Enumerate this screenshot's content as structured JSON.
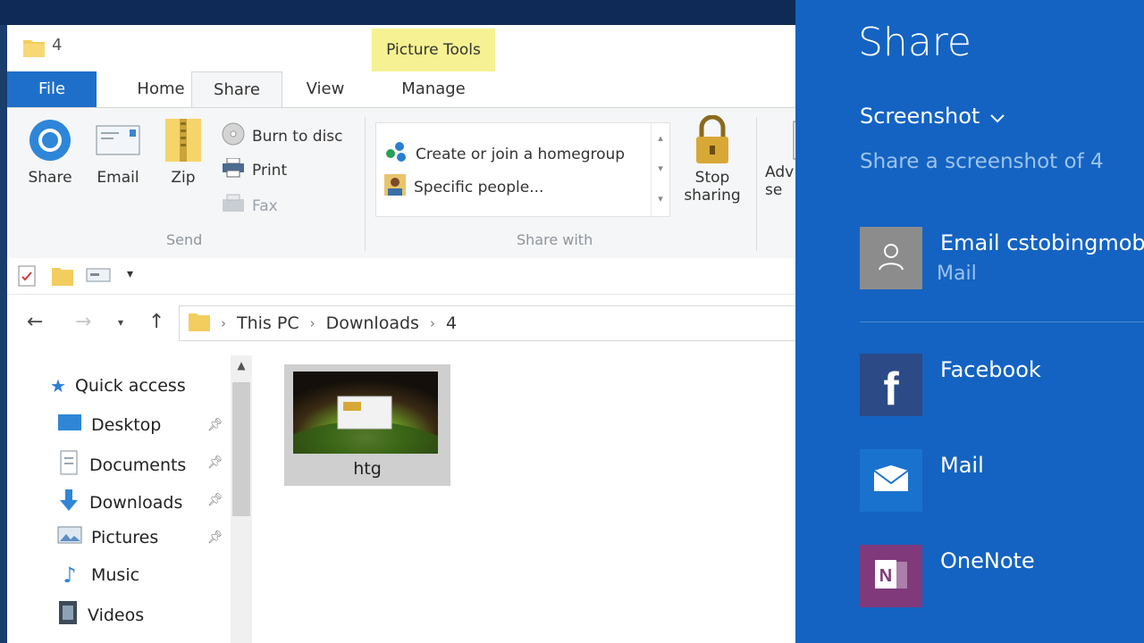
{
  "window": {
    "title": "4",
    "contextual_tab_group": "Picture Tools"
  },
  "tabs": [
    {
      "label": "File"
    },
    {
      "label": "Home"
    },
    {
      "label": "Share"
    },
    {
      "label": "View"
    },
    {
      "label": "Manage"
    }
  ],
  "ribbon": {
    "send": {
      "share_label": "Share",
      "email_label": "Email",
      "zip_label": "Zip",
      "burn_label": "Burn to disc",
      "print_label": "Print",
      "fax_label": "Fax",
      "group_label": "Send"
    },
    "share_with": {
      "homegroup_label": "Create or join a homegroup",
      "specific_people_label": "Specific people...",
      "group_label": "Share with"
    },
    "stop_sharing_label_1": "Stop",
    "stop_sharing_label_2": "sharing",
    "advanced_partial_1": "Adv",
    "advanced_partial_2": "se"
  },
  "breadcrumb": [
    "This PC",
    "Downloads",
    "4"
  ],
  "nav_pane": {
    "quick_access_label": "Quick access",
    "items": [
      {
        "label": "Desktop",
        "pinned": true
      },
      {
        "label": "Documents",
        "pinned": true
      },
      {
        "label": "Downloads",
        "pinned": true
      },
      {
        "label": "Pictures",
        "pinned": true
      },
      {
        "label": "Music",
        "pinned": false
      },
      {
        "label": "Videos",
        "pinned": false
      }
    ]
  },
  "files": [
    {
      "name": "htg"
    }
  ],
  "share_pane": {
    "title": "Share",
    "dropdown_label": "Screenshot",
    "subtitle": "Share a screenshot of 4",
    "recent": {
      "label": "Email cstobingmobil",
      "sub": "Mail"
    },
    "apps": [
      {
        "label": "Facebook",
        "color": "#2c4a86"
      },
      {
        "label": "Mail",
        "color": "#1a72cf"
      },
      {
        "label": "OneNote",
        "color": "#80397b"
      }
    ]
  },
  "colors": {
    "accent": "#1463c2",
    "file_tab": "#1e6fc9",
    "contextual_tab": "#f6f192"
  }
}
